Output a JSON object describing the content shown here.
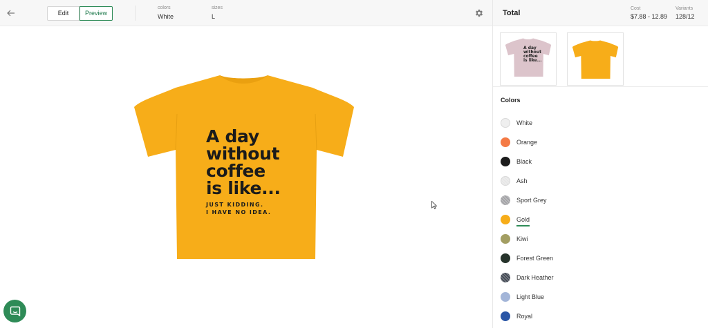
{
  "toolbar": {
    "edit_label": "Edit",
    "preview_label": "Preview",
    "colors_label": "colors",
    "colors_value": "White",
    "sizes_label": "sizes",
    "sizes_value": "L",
    "back_icon": "arrow-left-icon",
    "settings_icon": "gear-icon"
  },
  "preview": {
    "shirt_color": "#f7ad19",
    "shirt_lines": [
      "A day",
      "without",
      "coffee",
      "is like..."
    ],
    "shirt_small_lines": [
      "JUST KIDDING.",
      "I HAVE NO IDEA."
    ]
  },
  "panel": {
    "total_label": "Total",
    "cost_label": "Cost",
    "cost_value": "$7.88 - 12.89",
    "variants_label": "Variants",
    "variants_value": "128/12",
    "thumbnails": [
      {
        "view": "front",
        "color": "#dcc4cb"
      },
      {
        "view": "back",
        "color": "#f7ad19"
      }
    ],
    "thumb_front_lines": [
      "A day",
      "without",
      "coffee",
      "is like..."
    ],
    "colors_title": "Colors",
    "selected_color": "Gold",
    "colors": [
      {
        "name": "White",
        "hex": "#efefef"
      },
      {
        "name": "Orange",
        "hex": "#f47a45"
      },
      {
        "name": "Black",
        "hex": "#1c1c1c"
      },
      {
        "name": "Ash",
        "hex": "#e6e6e6"
      },
      {
        "name": "Sport Grey",
        "hex": "#a3a3a6"
      },
      {
        "name": "Gold",
        "hex": "#f7ad19"
      },
      {
        "name": "Kiwi",
        "hex": "#a39e62"
      },
      {
        "name": "Forest Green",
        "hex": "#26332b"
      },
      {
        "name": "Dark Heather",
        "hex": "#444a55"
      },
      {
        "name": "Light Blue",
        "hex": "#a3b5d8"
      },
      {
        "name": "Royal",
        "hex": "#2a56a6"
      }
    ]
  },
  "chat": {
    "icon": "chat-bubble-icon",
    "color": "#2e8b57"
  },
  "accent_color": "#2e8b57"
}
